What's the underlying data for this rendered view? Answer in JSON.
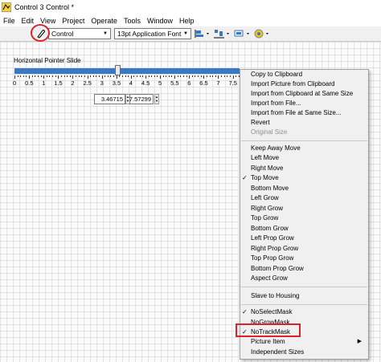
{
  "window": {
    "title": "Control 3 Control *"
  },
  "menubar": [
    "File",
    "Edit",
    "View",
    "Project",
    "Operate",
    "Tools",
    "Window",
    "Help"
  ],
  "toolbar": {
    "control_type": "Control",
    "font": "13pt Application Font"
  },
  "slide": {
    "label": "Horizontal Pointer Slide",
    "ticks": [
      "0",
      "0.5",
      "1",
      "1.5",
      "2",
      "2.5",
      "3",
      "3.5",
      "4",
      "4.5",
      "5",
      "5.5",
      "6",
      "6.5",
      "7",
      "7.5"
    ],
    "value_min": "3.46715",
    "value_max": "7.57299"
  },
  "context_menu": {
    "group1": [
      "Copy to Clipboard",
      "Import Picture from Clipboard",
      "Import from Clipboard at Same Size",
      "Import from File...",
      "Import from File at Same Size...",
      "Revert",
      "Original Size"
    ],
    "group2": [
      "Keep Away Move",
      "Left Move",
      "Right Move",
      "Top Move",
      "Bottom Move",
      "Left Grow",
      "Right Grow",
      "Top Grow",
      "Bottom Grow",
      "Left Prop Grow",
      "Right Prop Grow",
      "Top Prop Grow",
      "Bottom Prop Grow",
      "Aspect Grow"
    ],
    "group3": [
      "Slave to Housing"
    ],
    "group4": [
      "NoSelectMask",
      "NoGrowMask",
      "NoTrackMask",
      "Picture Item",
      "Independent Sizes"
    ],
    "check_mark": "✓",
    "submenu_arrow": "▶"
  },
  "colors": {
    "highlight_red": "#d9232b",
    "slide_blue": "#3a78c4"
  }
}
